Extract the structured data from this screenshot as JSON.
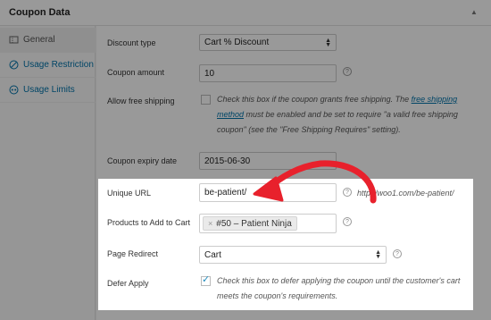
{
  "panel": {
    "title": "Coupon Data"
  },
  "sidebar": {
    "items": [
      {
        "label": "General",
        "icon": "ticket-icon"
      },
      {
        "label": "Usage Restriction",
        "icon": "restriction-icon"
      },
      {
        "label": "Usage Limits",
        "icon": "limits-icon"
      }
    ]
  },
  "fields": {
    "discount_type": {
      "label": "Discount type",
      "value": "Cart % Discount"
    },
    "coupon_amount": {
      "label": "Coupon amount",
      "value": "10"
    },
    "free_shipping": {
      "label": "Allow free shipping",
      "desc_1": "Check this box if the coupon grants free shipping. The ",
      "desc_link": "free shipping method",
      "desc_2": " must be enabled and be set to require \"a valid free shipping coupon\" (see the \"Free Shipping Requires\" setting)."
    },
    "expiry": {
      "label": "Coupon expiry date",
      "value": "2015-06-30"
    },
    "unique_url": {
      "label": "Unique URL",
      "value": "be-patient/",
      "full_url": "http://woo1.com/be-patient/"
    },
    "products": {
      "label": "Products to Add to Cart",
      "token": "#50 – Patient Ninja"
    },
    "page_redirect": {
      "label": "Page Redirect",
      "value": "Cart"
    },
    "defer_apply": {
      "label": "Defer Apply",
      "desc": "Check this box to defer applying the coupon until the customer's cart meets the coupon's requirements."
    }
  },
  "colors": {
    "accent": "#0073aa",
    "arrow": "#e8212c",
    "checkbox": "#1e8cbe"
  }
}
